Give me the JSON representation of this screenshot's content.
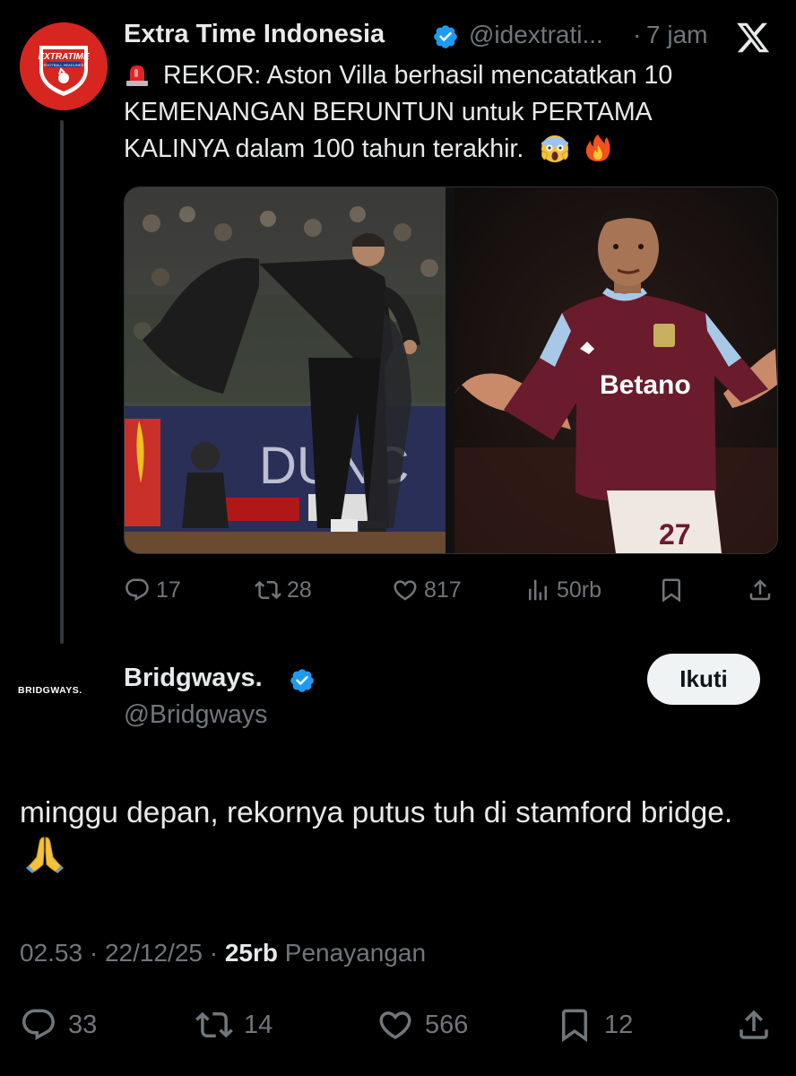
{
  "quoted_tweet": {
    "author_name": "Extra Time Indonesia",
    "handle": "@idextrati...",
    "separator": "·",
    "time_ago": "7 jam",
    "avatar_text_top": "EXTRATIME",
    "avatar_text_sub": "FOOTBALL HEADLINES",
    "text_line1": "REKOR: Aston Villa berhasil mencatatkan 10",
    "text_line2": "KEMENANGAN BERUNTUN untuk PERTAMA",
    "text_line3": "KALINYA dalam 100 tahun terakhir.",
    "shirt_sponsor": "Betano",
    "shirt_number": "27",
    "actions": {
      "replies": "17",
      "reposts": "28",
      "likes": "817",
      "views": "50rb"
    }
  },
  "main_tweet": {
    "author_name": "Bridgways.",
    "handle": "@Bridgways",
    "avatar_text": "BRIDGWAYS.",
    "follow_label": "Ikuti",
    "text": "minggu depan, rekornya putus tuh di stamford bridge.",
    "time": "02.53",
    "date": "22/12/25",
    "separator": "·",
    "views_count": "25rb",
    "views_label": "Penayangan",
    "actions": {
      "replies": "33",
      "reposts": "14",
      "likes": "566",
      "bookmarks": "12"
    }
  },
  "colors": {
    "background": "#000000",
    "text": "#e7e9ea",
    "muted": "#71767b",
    "verified": "#1d9bf0",
    "follow_bg": "#eff3f4"
  }
}
